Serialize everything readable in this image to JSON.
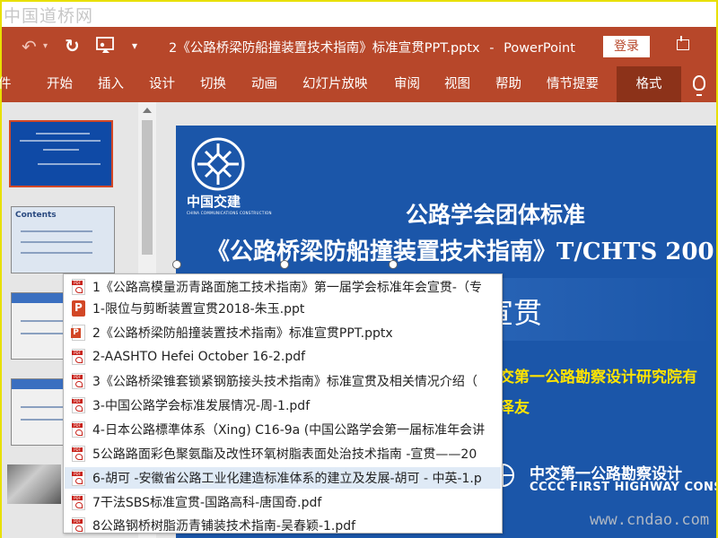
{
  "watermark": {
    "top": "中国道桥网",
    "bottom": "www.cndao.com"
  },
  "titlebar": {
    "document_title": "2《公路桥梁防船撞装置技术指南》标准宣贯PPT.pptx",
    "separator": "-",
    "app_name": "PowerPoint",
    "login_label": "登录"
  },
  "ribbon": {
    "tabs": [
      {
        "label": "件"
      },
      {
        "label": "开始"
      },
      {
        "label": "插入"
      },
      {
        "label": "设计"
      },
      {
        "label": "切换"
      },
      {
        "label": "动画"
      },
      {
        "label": "幻灯片放映"
      },
      {
        "label": "审阅"
      },
      {
        "label": "视图"
      },
      {
        "label": "帮助"
      },
      {
        "label": "情节提要"
      },
      {
        "label": "格式"
      }
    ],
    "active_tab": "格式"
  },
  "slide": {
    "logo_cn": "中国交建",
    "logo_en": "CHINA COMMUNICATIONS CONSTRUCTION",
    "line1": "公路学会团体标准",
    "line2": "《公路桥梁防船撞装置技术指南》T/CHTS 200",
    "line3": "准宣贯",
    "org": "交第一公路勘察设计研究院有",
    "name": "泽友",
    "corp_cn": "中交第一公路勘察设计",
    "corp_en": "CCCC FIRST HIGHWAY CONSU"
  },
  "thumbnails": [
    {
      "label": "公路学会团体标准"
    },
    {
      "label": "Contents"
    }
  ],
  "file_list": [
    {
      "icon": "pdf",
      "name": "1《公路高模量沥青路面施工技术指南》第一届学会标准年会宣贯-（专"
    },
    {
      "icon": "ppt",
      "name": "1-限位与剪断装置宣贯2018-朱玉.ppt"
    },
    {
      "icon": "pptx",
      "name": "2《公路桥梁防船撞装置技术指南》标准宣贯PPT.pptx"
    },
    {
      "icon": "pdf",
      "name": "2-AASHTO Hefei October 16-2.pdf"
    },
    {
      "icon": "pdf",
      "name": "3《公路桥梁锥套锁紧钢筋接头技术指南》标准宣贯及相关情况介绍（"
    },
    {
      "icon": "pdf",
      "name": "3-中国公路学会标准发展情况-周-1.pdf"
    },
    {
      "icon": "pdf",
      "name": "4-日本公路標準体系（Xing) C16-9a (中国公路学会第一届标准年会讲"
    },
    {
      "icon": "pdf",
      "name": "5公路路面彩色聚氨酯及改性环氧树脂表面处治技术指南 -宣贯——20"
    },
    {
      "icon": "pdf",
      "name": "6-胡可 -安徽省公路工业化建造标准体系的建立及发展-胡可 - 中英-1.p"
    },
    {
      "icon": "pdf",
      "name": "7干法SBS标准宣贯-国路高科-唐国奇.pdf"
    },
    {
      "icon": "pdf",
      "name": "8公路钢桥树脂沥青铺装技术指南-吴春颖-1.pdf"
    }
  ],
  "colors": {
    "accent": "#b7472a",
    "active_tab": "#8c3219",
    "slide_bg": "#1b56a9",
    "slide_highlight": "#ffe400",
    "list_highlight": "#dfeaf6"
  }
}
